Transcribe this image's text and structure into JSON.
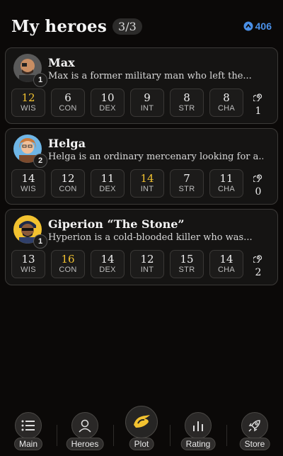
{
  "header": {
    "title": "My heroes",
    "count": "3/3",
    "balance": "406",
    "accent": "#4a90e8"
  },
  "heroes": [
    {
      "name": "Max",
      "level": "1",
      "description": "Max is a former military man who left the...",
      "stats": [
        {
          "value": "12",
          "label": "WIS",
          "highlight": true
        },
        {
          "value": "6",
          "label": "CON",
          "highlight": false
        },
        {
          "value": "10",
          "label": "DEX",
          "highlight": false
        },
        {
          "value": "9",
          "label": "INT",
          "highlight": false
        },
        {
          "value": "8",
          "label": "STR",
          "highlight": false
        },
        {
          "value": "8",
          "label": "CHA",
          "highlight": false
        }
      ],
      "spiral": "1"
    },
    {
      "name": "Helga",
      "level": "2",
      "description": "Helga is an ordinary mercenary looking for a...",
      "stats": [
        {
          "value": "14",
          "label": "WIS",
          "highlight": false
        },
        {
          "value": "12",
          "label": "CON",
          "highlight": false
        },
        {
          "value": "11",
          "label": "DEX",
          "highlight": false
        },
        {
          "value": "14",
          "label": "INT",
          "highlight": true
        },
        {
          "value": "7",
          "label": "STR",
          "highlight": false
        },
        {
          "value": "11",
          "label": "CHA",
          "highlight": false
        }
      ],
      "spiral": "0"
    },
    {
      "name": "Giperion “The Stone”",
      "level": "1",
      "description": "Hyperion is a cold-blooded killer who was...",
      "stats": [
        {
          "value": "13",
          "label": "WIS",
          "highlight": false
        },
        {
          "value": "16",
          "label": "CON",
          "highlight": true
        },
        {
          "value": "14",
          "label": "DEX",
          "highlight": false
        },
        {
          "value": "12",
          "label": "INT",
          "highlight": false
        },
        {
          "value": "15",
          "label": "STR",
          "highlight": false
        },
        {
          "value": "14",
          "label": "CHA",
          "highlight": false
        }
      ],
      "spiral": "2"
    }
  ],
  "nav": [
    {
      "label": "Main",
      "icon": "list-icon"
    },
    {
      "label": "Heroes",
      "icon": "person-icon"
    },
    {
      "label": "Plot",
      "icon": "plot-logo-icon"
    },
    {
      "label": "Rating",
      "icon": "bar-chart-icon"
    },
    {
      "label": "Store",
      "icon": "rocket-icon"
    }
  ]
}
